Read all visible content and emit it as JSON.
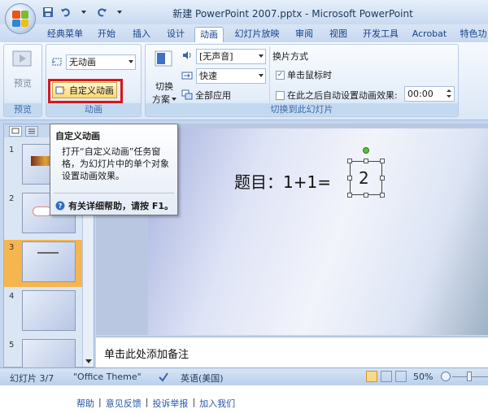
{
  "window": {
    "title": "新建 PowerPoint 2007.pptx - Microsoft PowerPoint"
  },
  "tabs": [
    "经典菜单",
    "开始",
    "插入",
    "设计",
    "动画",
    "幻灯片放映",
    "审阅",
    "视图",
    "开发工具",
    "Acrobat",
    "特色功"
  ],
  "active_tab": "动画",
  "ribbon": {
    "preview": {
      "button": "预览",
      "group": "预览"
    },
    "animation": {
      "animate_combo": "无动画",
      "custom_animation": "自定义动画",
      "group": "动画"
    },
    "transition": {
      "apply_label_line1": "切换",
      "apply_label_line2": "方案",
      "sound_combo": "[无声音]",
      "speed_combo": "快速",
      "apply_all": "全部应用",
      "advance_title": "换片方式",
      "on_click": "单击鼠标时",
      "on_click_checked": true,
      "auto_after": "在此之后自动设置动画效果:",
      "auto_after_checked": false,
      "auto_time": "00:00",
      "group": "切换到此幻灯片"
    }
  },
  "tooltip": {
    "title": "自定义动画",
    "body": "打开“自定义动画”任务窗格，为幻灯片中的单个对象设置动画效果。",
    "help": "有关详细帮助，请按 F1。"
  },
  "slides": [
    {
      "number": "1"
    },
    {
      "number": "2"
    },
    {
      "number": "3",
      "selected": true
    },
    {
      "number": "4"
    },
    {
      "number": "5"
    }
  ],
  "slide": {
    "question": "题目：1+1=",
    "answer": "2"
  },
  "notes_placeholder": "单击此处添加备注",
  "status": {
    "slide_info": "幻灯片 3/7",
    "theme": "\"Office Theme\"",
    "language": "英语(美国)",
    "zoom": "50%"
  },
  "footer": {
    "links": [
      "帮助",
      "意见反馈",
      "投诉举报",
      "加入我们"
    ]
  },
  "colors": {
    "highlight_border": "#d9151b",
    "selected_thumb": "#f6b54e"
  }
}
